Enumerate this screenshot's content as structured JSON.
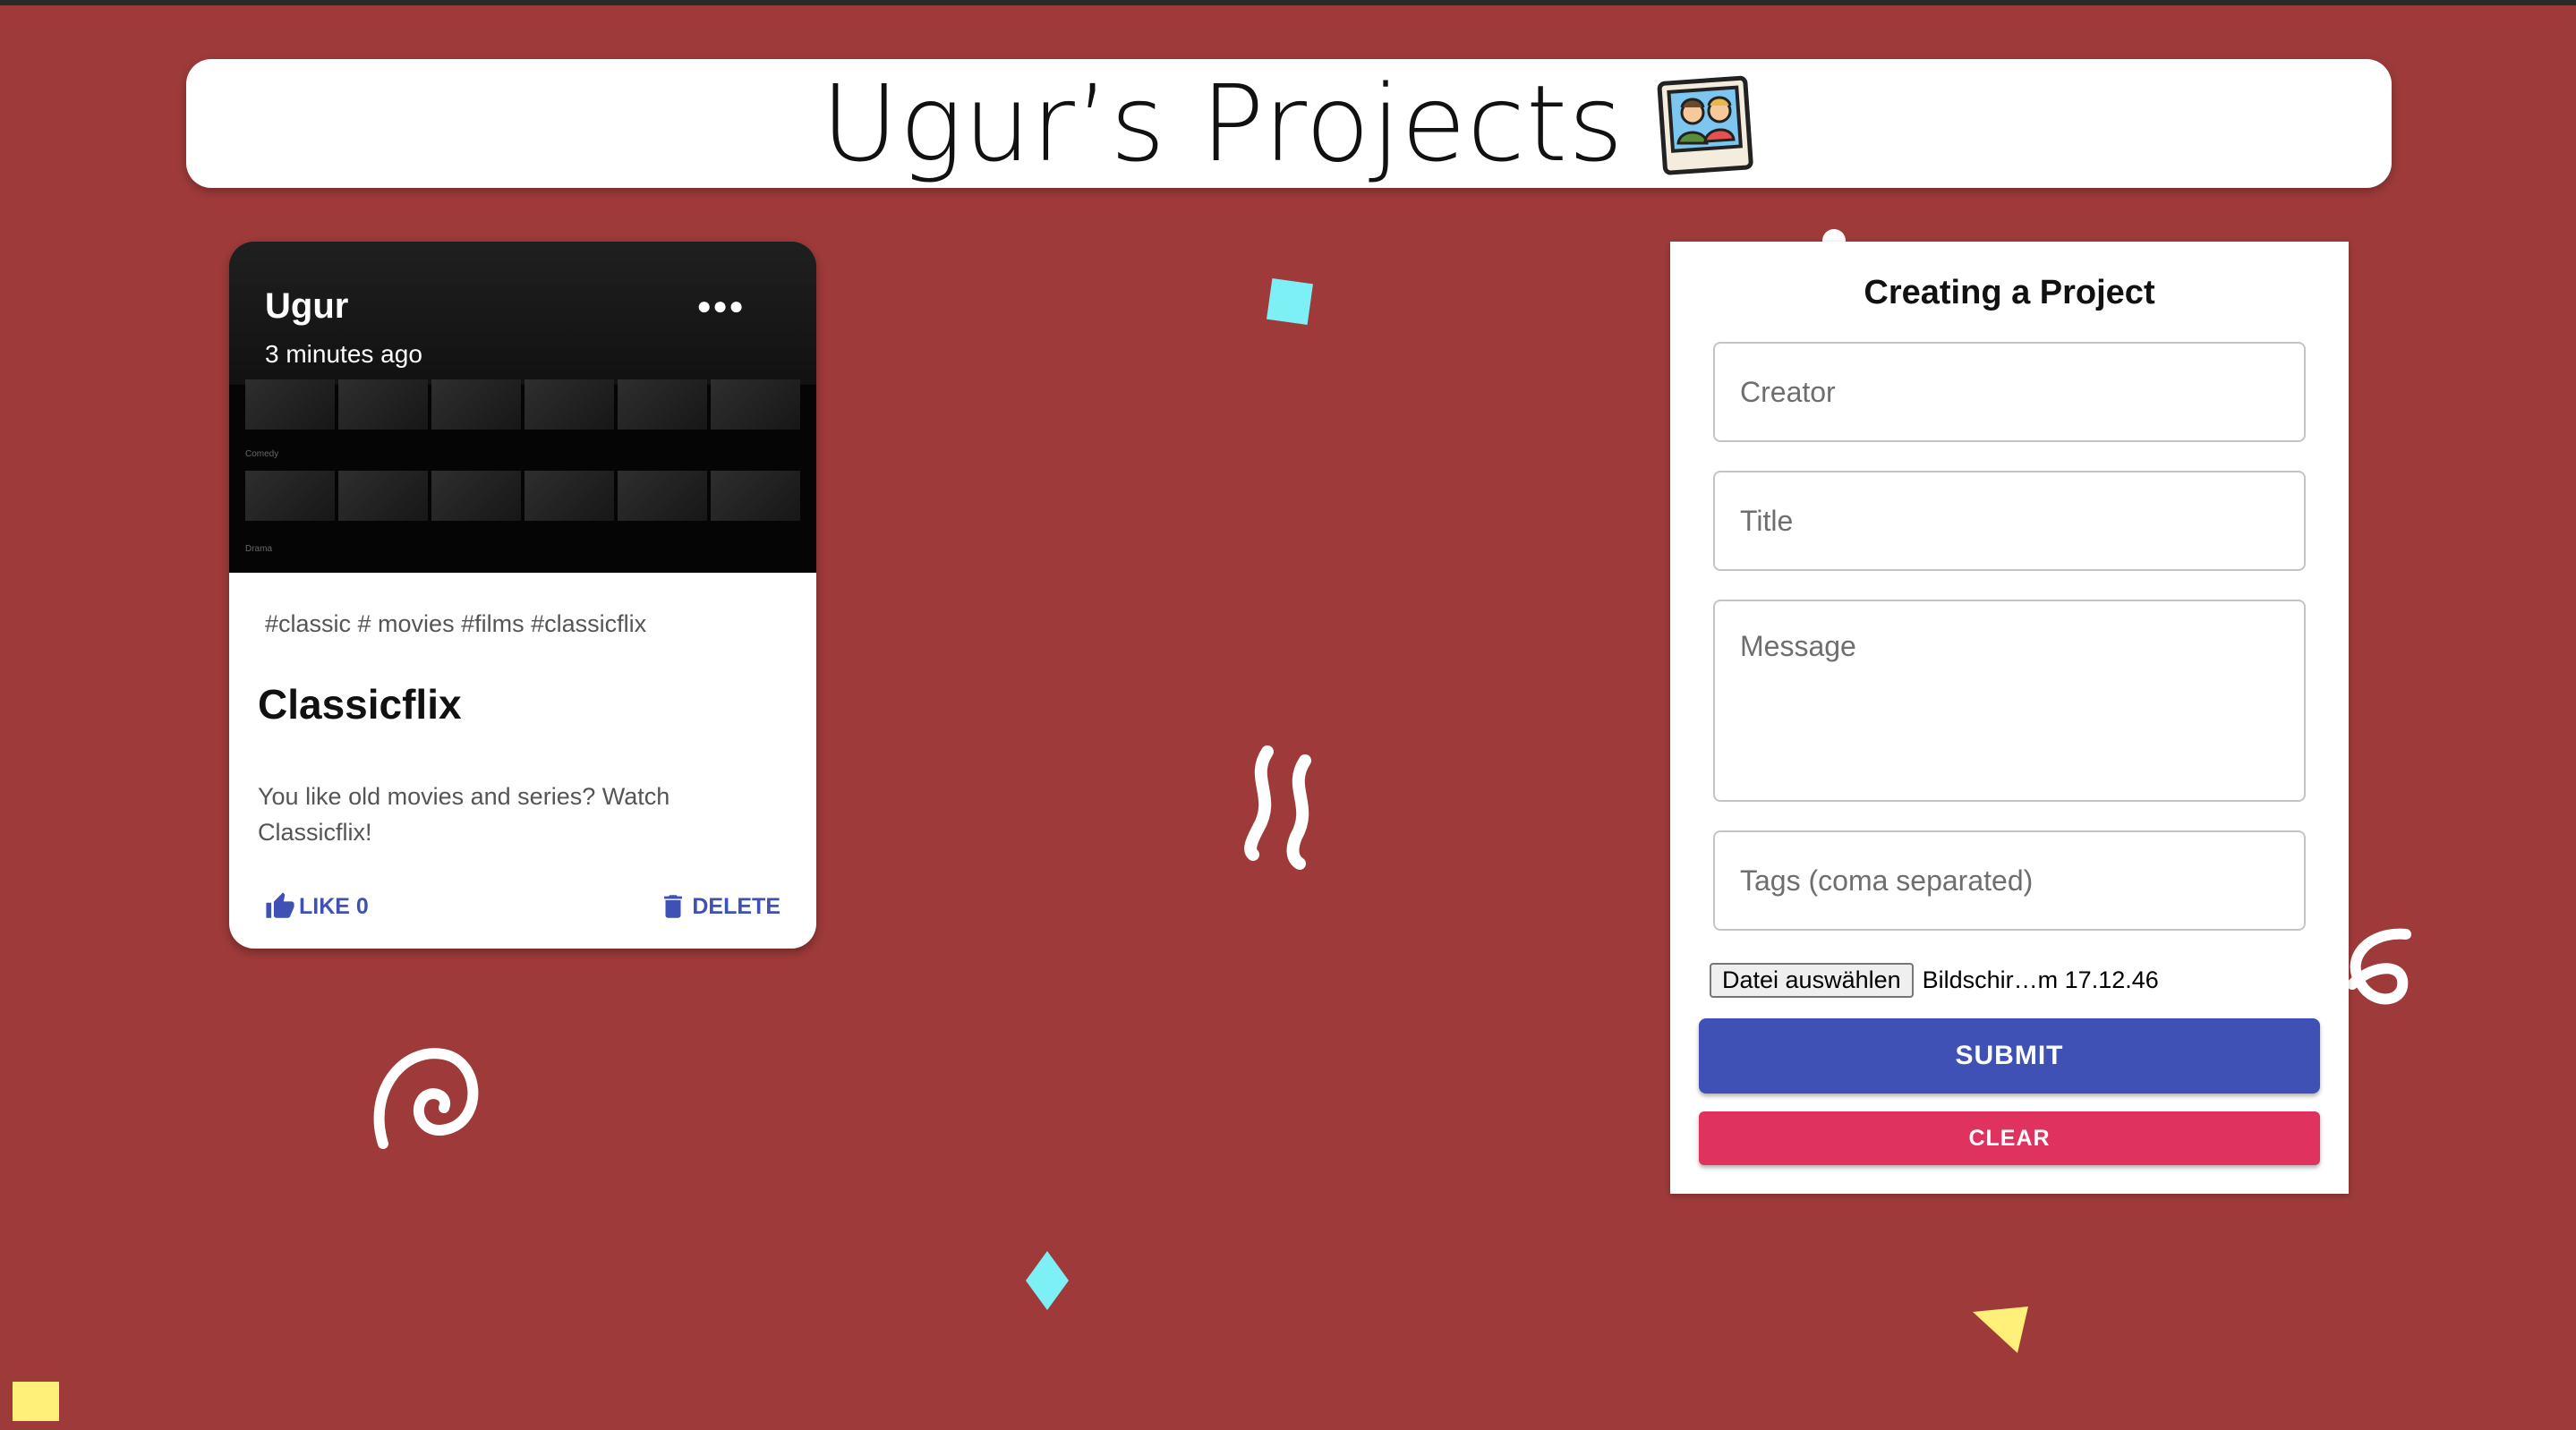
{
  "colors": {
    "background": "#9e3a3a",
    "primary": "#3f51b5",
    "secondary": "#e0325f",
    "confetti_cyan": "#7df0f5",
    "confetti_yellow": "#fff07a"
  },
  "header": {
    "title": "Ugur’s Projects",
    "icon": "photo-polaroid-icon"
  },
  "post": {
    "creator": "Ugur",
    "time": "3 minutes ago",
    "more_icon": "more-horizontal-icon",
    "media_labels": [
      "Comedy",
      "Drama"
    ],
    "tags": "#classic # movies #films #classicflix",
    "title": "Classicflix",
    "message": "You like old movies and series? Watch Classicflix!",
    "like_label": "LIKE 0",
    "like_icon": "thumb-up-icon",
    "delete_label": "DELETE",
    "delete_icon": "trash-icon"
  },
  "form": {
    "heading": "Creating a Project",
    "creator_placeholder": "Creator",
    "title_placeholder": "Title",
    "message_placeholder": "Message",
    "tags_placeholder": "Tags (coma separated)",
    "file_button_label": "Datei auswählen",
    "file_name": "Bildschir…m 17.12.46",
    "submit_label": "SUBMIT",
    "clear_label": "CLEAR"
  }
}
